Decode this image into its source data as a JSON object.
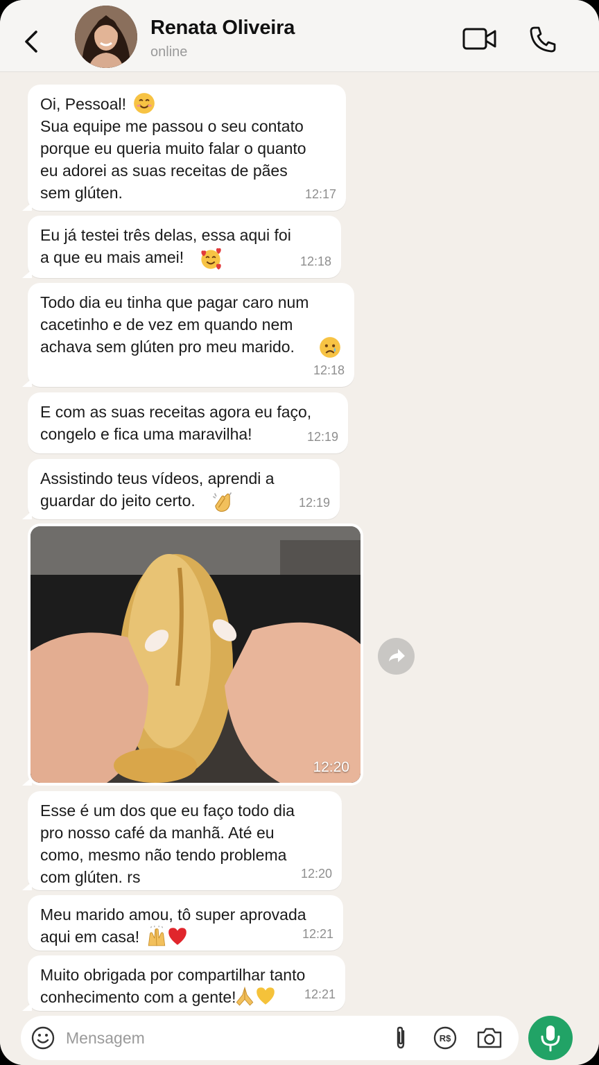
{
  "header": {
    "name": "Renata Oliveira",
    "status": "online"
  },
  "messages": [
    {
      "text": "Oi, Pessoal! \nSua equipe me passou o seu contato\nporque eu queria muito falar o quanto\neu adorei as suas receitas de pães\nsem glúten.",
      "time": "12:17",
      "emoji": "smiling-face"
    },
    {
      "text": "Eu já testei três delas, essa aqui foi\na que eu mais amei!",
      "time": "12:18",
      "emoji": "smiling-face-with-hearts"
    },
    {
      "text": "Todo dia eu tinha que pagar caro num\ncacetinho e de vez em quando nem\nachava sem glúten pro meu marido.",
      "time": "12:18",
      "emoji": "crying-face"
    },
    {
      "text": "E com as suas receitas agora eu faço,\ncongelo e fica uma maravilha!",
      "time": "12:19"
    },
    {
      "text": "Assistindo teus vídeos, aprendi a\nguardar do jeito certo.",
      "time": "12:19",
      "emoji": "clapping-hands"
    },
    {
      "text": "Esse é um dos que eu faço todo dia\npro nosso café da manhã. Até eu\ncomo, mesmo não tendo problema\ncom glúten. rs",
      "time": "12:20"
    },
    {
      "text": "Meu marido amou, tô super aprovada\naqui em casa!",
      "time": "12:21",
      "emoji": "raising-hands-and-red-heart"
    },
    {
      "text": "Muito obrigada por compartilhar tanto\nconhecimento com a gente!",
      "time": "12:21",
      "emoji": "folded-hands-and-yellow-heart"
    }
  ],
  "photo": {
    "time": "12:20",
    "subject": "bread-roll-photo"
  },
  "composer": {
    "placeholder": "Mensagem"
  },
  "colors": {
    "background": "#f3efea",
    "bubble": "#ffffff",
    "mic_button": "#21a366",
    "timestamp": "#8e8e8e"
  }
}
